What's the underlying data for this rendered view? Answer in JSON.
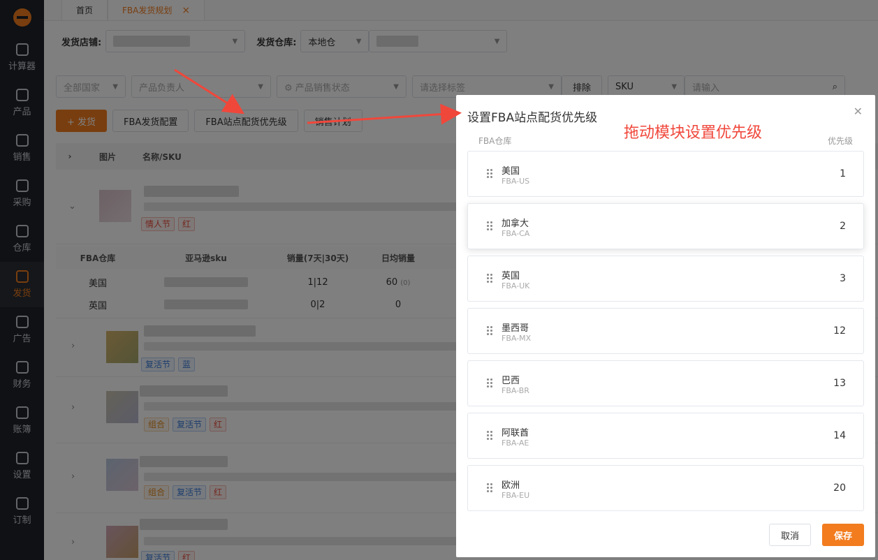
{
  "sidebar": {
    "items": [
      {
        "label": "计算器",
        "icon": "calculator-icon"
      },
      {
        "label": "产品",
        "icon": "box-icon"
      },
      {
        "label": "销售",
        "icon": "chart-icon"
      },
      {
        "label": "采购",
        "icon": "basket-icon"
      },
      {
        "label": "仓库",
        "icon": "warehouse-icon"
      },
      {
        "label": "发货",
        "icon": "ship-icon"
      },
      {
        "label": "广告",
        "icon": "ad-icon"
      },
      {
        "label": "财务",
        "icon": "yen-icon"
      },
      {
        "label": "账簿",
        "icon": "ledger-icon"
      },
      {
        "label": "设置",
        "icon": "gear-icon"
      },
      {
        "label": "订制",
        "icon": "monitor-icon"
      }
    ],
    "active_index": 5
  },
  "tabs": [
    {
      "label": "首页"
    },
    {
      "label": "FBA发货规划"
    }
  ],
  "filters": {
    "store_label": "发货店铺:",
    "warehouse_label": "发货仓库:",
    "warehouse_value": "本地仓",
    "country_placeholder": "全部国家",
    "owner_placeholder": "产品负责人",
    "status_placeholder": "产品销售状态",
    "tag_placeholder": "请选择标签",
    "exclude_label": "排除",
    "sku_value": "SKU",
    "search_placeholder": "请输入"
  },
  "actions": {
    "ship": "+ 发货",
    "fba_config": "FBA发货配置",
    "fba_priority": "FBA站点配货优先级",
    "sales_plan": "销售计划"
  },
  "table": {
    "headers": [
      "图片",
      "名称/SKU"
    ],
    "product1_tags": [
      "情人节",
      "红"
    ],
    "sub_headers": [
      "FBA仓库",
      "亚马逊sku",
      "销量(7天|30天)",
      "日均销量"
    ],
    "sub_rows": [
      {
        "wh": "美国",
        "sales": "1|12",
        "daily": "60",
        "daily_note": "(0)"
      },
      {
        "wh": "英国",
        "sales": "0|2",
        "daily": "0",
        "daily_note": ""
      }
    ],
    "product2_tags": [
      "复活节",
      "蓝"
    ],
    "product3_tags": [
      "组合",
      "复活节",
      "红"
    ],
    "product4_tags": [
      "组合",
      "复活节",
      "红"
    ],
    "product5_tags": [
      "复活节",
      "红"
    ]
  },
  "dialog": {
    "title": "设置FBA站点配货优先级",
    "annotation": "拖动模块设置优先级",
    "col_left": "FBA仓库",
    "col_right": "优先级",
    "items": [
      {
        "name": "美国",
        "code": "FBA-US",
        "priority": "1"
      },
      {
        "name": "加拿大",
        "code": "FBA-CA",
        "priority": "2"
      },
      {
        "name": "英国",
        "code": "FBA-UK",
        "priority": "3"
      },
      {
        "name": "墨西哥",
        "code": "FBA-MX",
        "priority": "12"
      },
      {
        "name": "巴西",
        "code": "FBA-BR",
        "priority": "13"
      },
      {
        "name": "阿联酋",
        "code": "FBA-AE",
        "priority": "14"
      },
      {
        "name": "欧洲",
        "code": "FBA-EU",
        "priority": "20"
      }
    ],
    "cancel": "取消",
    "save": "保存"
  },
  "colors": {
    "accent": "#f27c1e",
    "annotation": "#f0473b"
  }
}
